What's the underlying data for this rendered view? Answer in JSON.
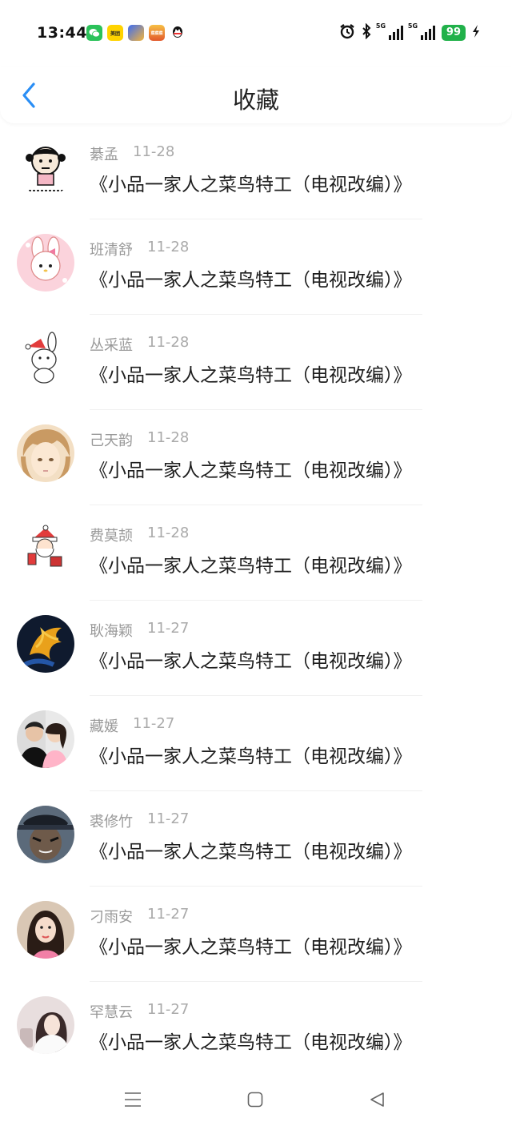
{
  "status_bar": {
    "time": "13:44",
    "app_icons": [
      "wechat-icon",
      "meituan-icon",
      "game-icon",
      "food-icon",
      "qq-icon"
    ],
    "meituan_label": "美团",
    "food_label": "菜菜菜",
    "network_1": "5G",
    "network_2": "5G",
    "battery": "99",
    "battery_color": "#21b14a"
  },
  "header": {
    "title": "收藏",
    "accent": "#2a8ef5"
  },
  "items": [
    {
      "name": "綦孟",
      "date": "11-28",
      "title": "《小品一家人之菜鸟特工（电视改编）》"
    },
    {
      "name": "班清舒",
      "date": "11-28",
      "title": "《小品一家人之菜鸟特工（电视改编）》"
    },
    {
      "name": "丛采蓝",
      "date": "11-28",
      "title": "《小品一家人之菜鸟特工（电视改编）》"
    },
    {
      "name": "己天韵",
      "date": "11-28",
      "title": "《小品一家人之菜鸟特工（电视改编）》"
    },
    {
      "name": "费莫颉",
      "date": "11-28",
      "title": "《小品一家人之菜鸟特工（电视改编）》"
    },
    {
      "name": "耿海颖",
      "date": "11-27",
      "title": "《小品一家人之菜鸟特工（电视改编）》"
    },
    {
      "name": "藏媛",
      "date": "11-27",
      "title": "《小品一家人之菜鸟特工（电视改编）》"
    },
    {
      "name": "裘修竹",
      "date": "11-27",
      "title": "《小品一家人之菜鸟特工（电视改编）》"
    },
    {
      "name": "刁雨安",
      "date": "11-27",
      "title": "《小品一家人之菜鸟特工（电视改编）》"
    },
    {
      "name": "罕慧云",
      "date": "11-27",
      "title": "《小品一家人之菜鸟特工（电视改编）》"
    }
  ]
}
